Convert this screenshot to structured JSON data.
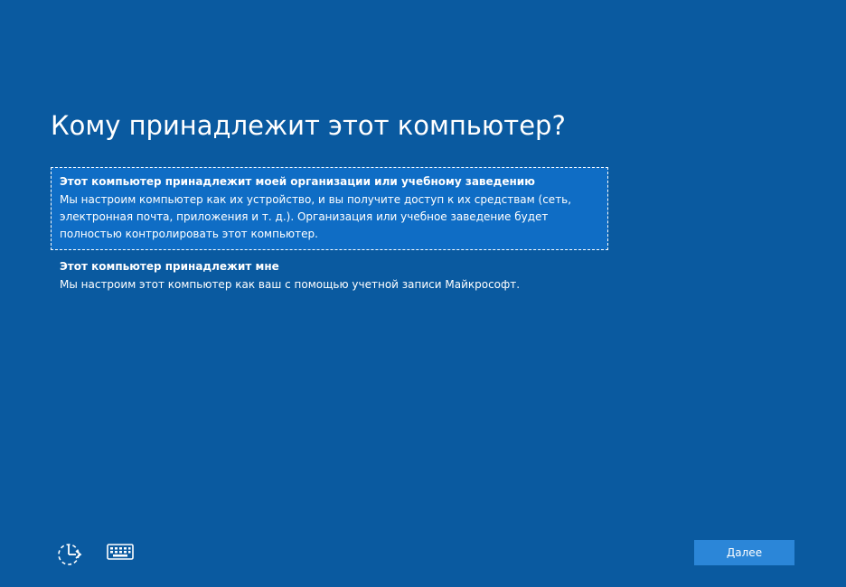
{
  "page": {
    "title": "Кому принадлежит этот компьютер?"
  },
  "options": [
    {
      "title": "Этот компьютер принадлежит моей организации или учебному заведению",
      "description": "Мы настроим компьютер как их устройство, и вы получите доступ к их средствам (сеть, электронная почта, приложения и т. д.). Организация или учебное заведение будет полностью контролировать этот компьютер.",
      "selected": true
    },
    {
      "title": "Этот компьютер принадлежит мне",
      "description": "Мы настроим этот компьютер как ваш с помощью учетной записи Майкрософт.",
      "selected": false
    }
  ],
  "footer": {
    "next_label": "Далее",
    "icons": [
      "accessibility-icon",
      "keyboard-icon"
    ]
  },
  "colors": {
    "background": "#0a5aa0",
    "selected_option": "#0f6dc5",
    "button": "#2b86d8",
    "text": "#ffffff"
  }
}
